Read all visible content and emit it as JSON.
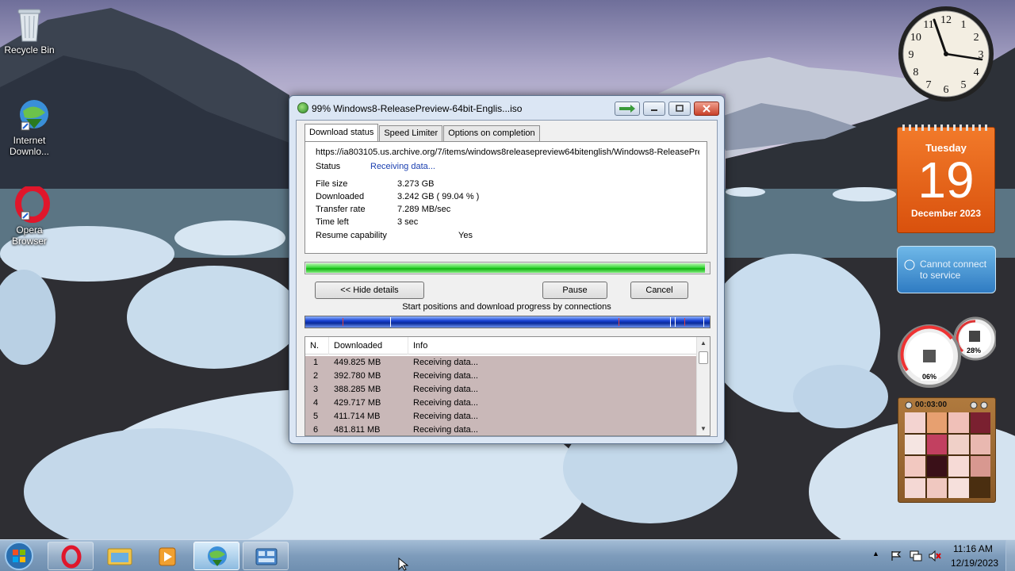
{
  "desktop": {
    "icons": [
      {
        "label": "Recycle Bin"
      },
      {
        "label": "Internet Downlo..."
      },
      {
        "label": "Opera Browser"
      }
    ]
  },
  "dialog": {
    "title": "99% Windows8-ReleasePreview-64bit-Englis...iso",
    "tabs": [
      "Download status",
      "Speed Limiter",
      "Options on completion"
    ],
    "url": "https://ia803105.us.archive.org/7/items/windows8releasepreview64bitenglish/Windows8-ReleasePre",
    "status_label": "Status",
    "status_value": "Receiving data...",
    "file_size_label": "File size",
    "file_size": "3.273  GB",
    "downloaded_label": "Downloaded",
    "downloaded": "3.242  GB  ( 99.04 % )",
    "transfer_rate_label": "Transfer rate",
    "transfer_rate": "7.289  MB/sec",
    "time_left_label": "Time left",
    "time_left": "3 sec",
    "resume_label": "Resume capability",
    "resume_value": "Yes",
    "progress_fraction": 0.9904,
    "hide_details_label": "<< Hide details",
    "pause_label": "Pause",
    "cancel_label": "Cancel",
    "connections_caption": "Start positions and download progress by connections",
    "table": {
      "columns": [
        "N.",
        "Downloaded",
        "Info"
      ],
      "rows": [
        {
          "n": "1",
          "downloaded": "449.825  MB",
          "info": "Receiving data..."
        },
        {
          "n": "2",
          "downloaded": "392.780  MB",
          "info": "Receiving data..."
        },
        {
          "n": "3",
          "downloaded": "388.285  MB",
          "info": "Receiving data..."
        },
        {
          "n": "4",
          "downloaded": "429.717  MB",
          "info": "Receiving data..."
        },
        {
          "n": "5",
          "downloaded": "411.714  MB",
          "info": "Receiving data..."
        },
        {
          "n": "6",
          "downloaded": "481.811  MB",
          "info": "Receiving data..."
        }
      ]
    }
  },
  "gadgets": {
    "clock_numbers": [
      "12",
      "1",
      "2",
      "3",
      "4",
      "5",
      "6",
      "7",
      "8",
      "9",
      "10",
      "11"
    ],
    "calendar": {
      "weekday": "Tuesday",
      "day": "19",
      "month_year": "December 2023"
    },
    "weather": {
      "message": "Cannot connect to service"
    },
    "cpu_meter": {
      "cpu": "06%",
      "memory": "28%"
    },
    "puzzle": {
      "timer": "00:03:00"
    }
  },
  "taskbar": {
    "time": "11:16 AM",
    "date": "12/19/2023"
  },
  "colors": {
    "calendar_orange": "#e8611a",
    "progress_green": "#22c022",
    "status_blue": "#1a3fb0"
  }
}
